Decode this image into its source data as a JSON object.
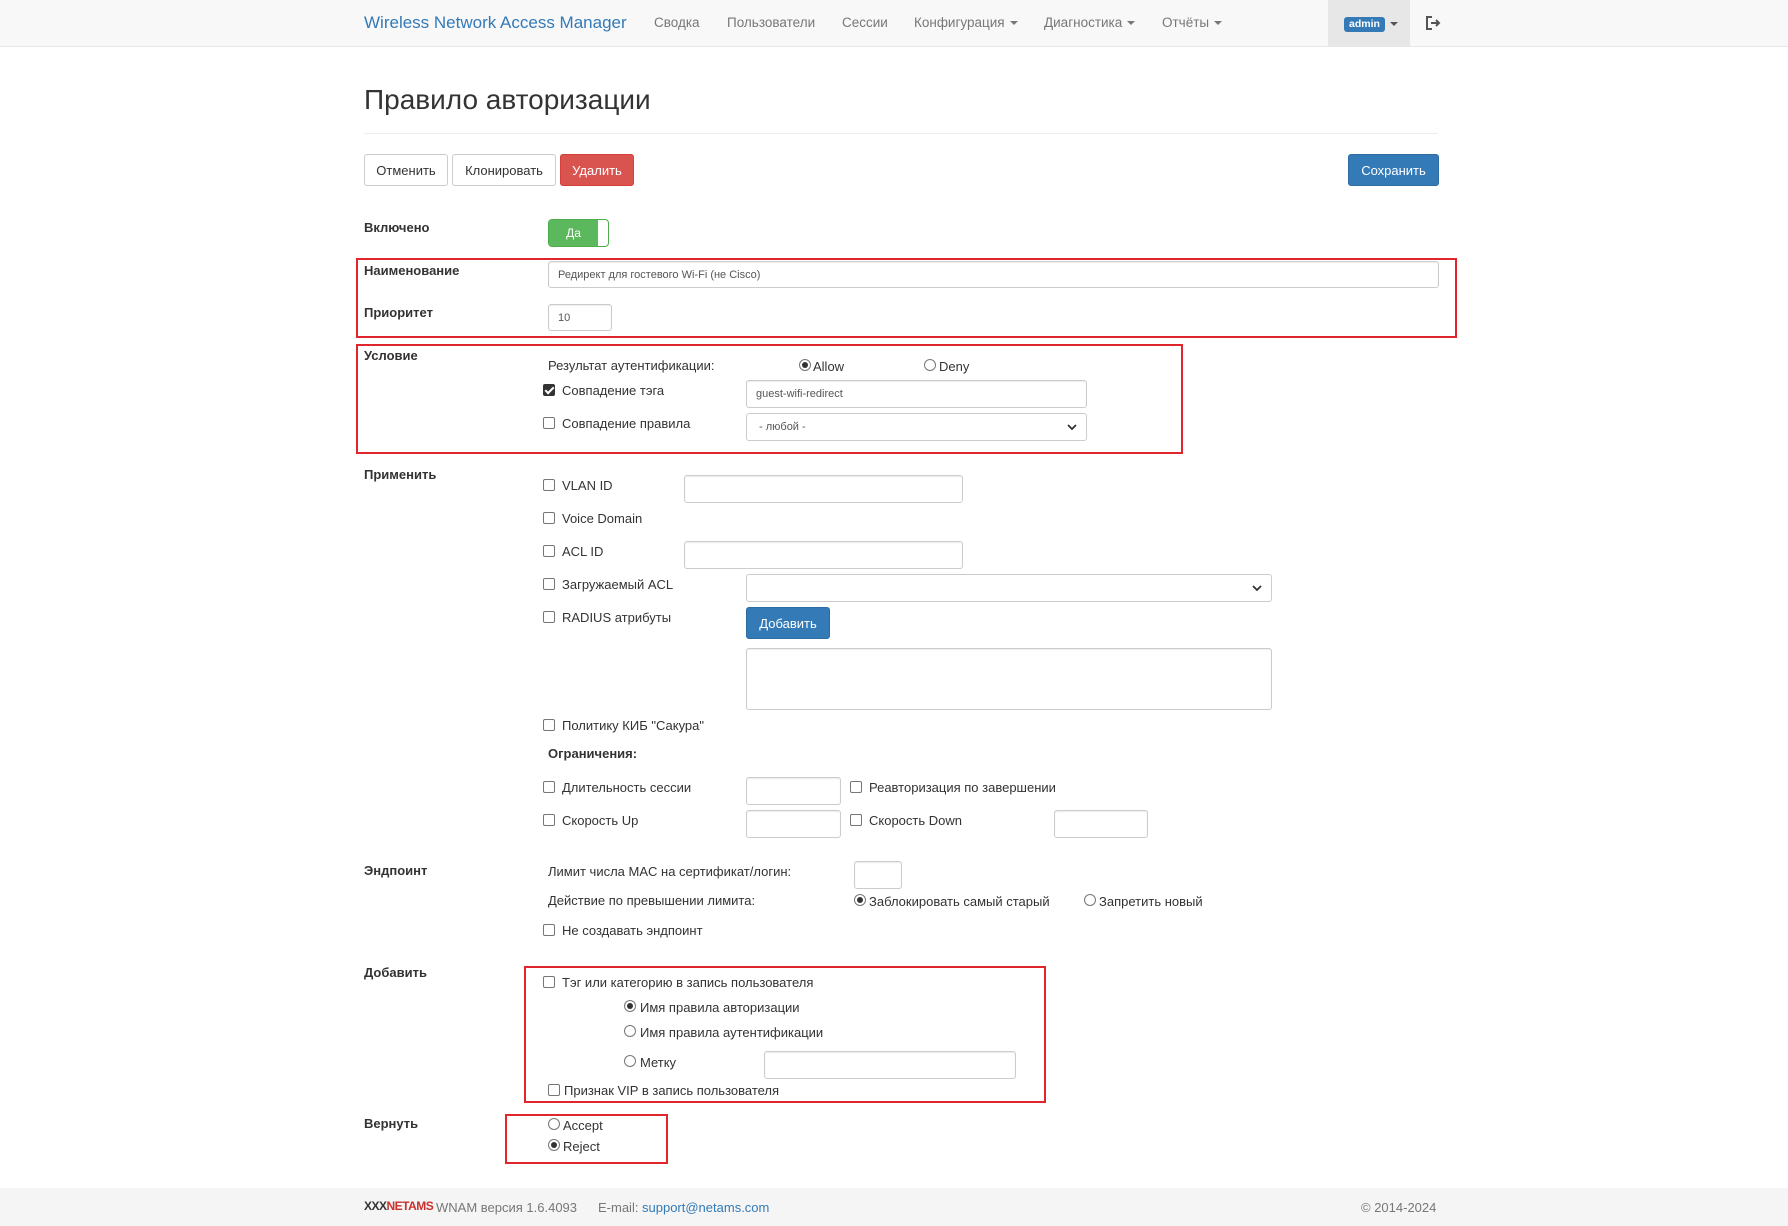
{
  "navbar": {
    "brand": "Wireless Network Access Manager",
    "items": [
      "Сводка",
      "Пользователи",
      "Сессии",
      "Конфигурация",
      "Диагностика",
      "Отчёты"
    ],
    "user": "admin"
  },
  "page": {
    "title": "Правило авторизации",
    "buttons": {
      "cancel": "Отменить",
      "clone": "Клонировать",
      "delete": "Удалить",
      "save": "Сохранить"
    }
  },
  "form": {
    "enabled": {
      "label": "Включено",
      "value": "Да"
    },
    "name": {
      "label": "Наименование",
      "value": "Редирект для гостевого Wi-Fi (не Cisco)"
    },
    "priority": {
      "label": "Приоритет",
      "value": "10"
    },
    "condition": {
      "label": "Условие",
      "auth_result_label": "Результат аутентификации:",
      "allow": "Allow",
      "deny": "Deny",
      "tag_match": "Совпадение тэга",
      "tag_value": "guest-wifi-redirect",
      "rule_match": "Совпадение правила",
      "rule_value": "- любой -"
    },
    "apply": {
      "label": "Применить",
      "vlan_id": "VLAN ID",
      "voice_domain": "Voice Domain",
      "acl_id": "ACL ID",
      "downloadable_acl": "Загружаемый ACL",
      "radius_attrs": "RADIUS атрибуты",
      "add_button": "Добавить",
      "kib_policy": "Политику КИБ \"Сакура\"",
      "limits_label": "Ограничения:",
      "session_duration": "Длительность сессии",
      "reauth": "Реавторизация по завершении",
      "speed_up": "Скорость Up",
      "speed_down": "Скорость Down"
    },
    "endpoint": {
      "label": "Эндпоинт",
      "mac_limit": "Лимит числа MAC на сертификат/логин:",
      "exceed_action": "Действие по превышении лимита:",
      "block_oldest": "Заблокировать самый старый",
      "deny_new": "Запретить новый",
      "no_create": "Не создавать эндпоинт"
    },
    "add": {
      "label": "Добавить",
      "tag_or_category": "Тэг или категорию в запись пользователя",
      "authz_rule_name": "Имя правила авторизации",
      "authn_rule_name": "Имя правила аутентификации",
      "mark": "Метку",
      "vip": "Признак VIP в запись пользователя"
    },
    "return": {
      "label": "Вернуть",
      "accept": "Accept",
      "reject": "Reject"
    }
  },
  "footer": {
    "logo": "NETAMS",
    "version": "WNAM версия 1.6.4093",
    "email_label": "E-mail:",
    "email": "support@netams.com",
    "copyright": "© 2014-2024"
  },
  "colors": {
    "primary": "#337ab7",
    "danger": "#d9534f",
    "success": "#5cb85c",
    "highlight": "#e0252b"
  }
}
